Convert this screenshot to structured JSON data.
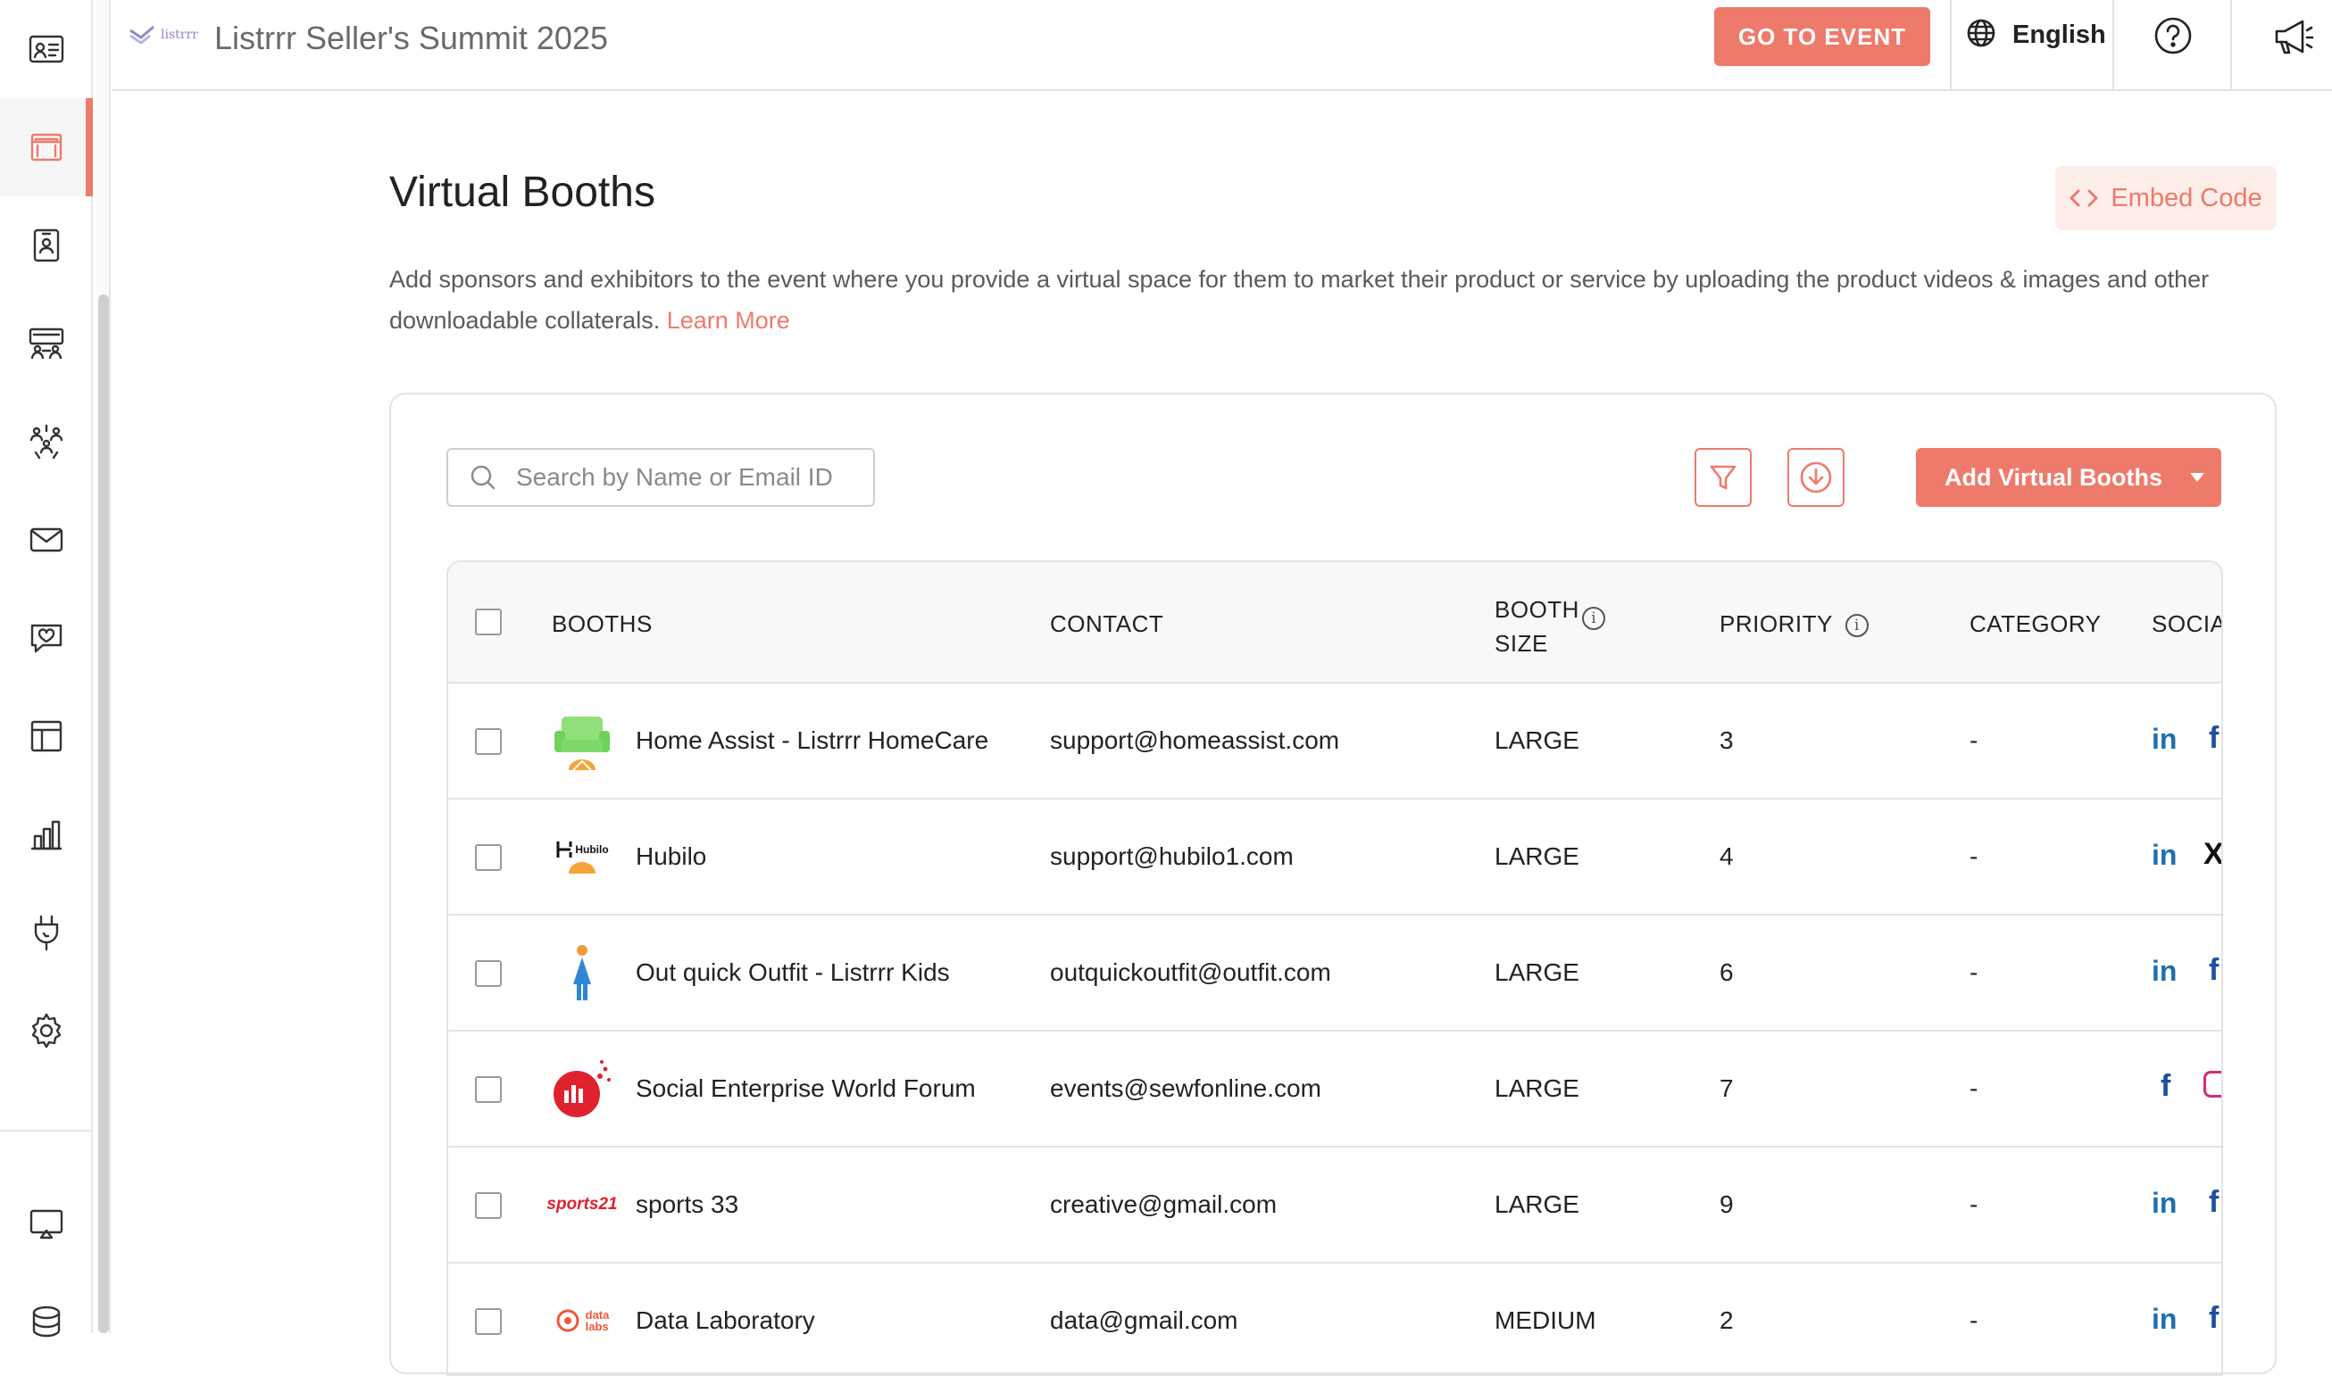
{
  "app": {
    "logo_text": "listrrr",
    "title": "Listrrr Seller's Summit 2025",
    "go_to_event_label": "GO TO EVENT",
    "language": "English"
  },
  "sidebar": {
    "items": [
      {
        "name": "attendees-icon"
      },
      {
        "name": "booth-icon",
        "active": true
      },
      {
        "name": "badge-icon"
      },
      {
        "name": "lounge-icon"
      },
      {
        "name": "networking-icon"
      },
      {
        "name": "mail-icon"
      },
      {
        "name": "engagement-icon"
      },
      {
        "name": "layout-icon"
      },
      {
        "name": "analytics-icon"
      },
      {
        "name": "integrations-icon"
      },
      {
        "name": "settings-icon"
      },
      {
        "name": "display-icon"
      },
      {
        "name": "database-icon"
      }
    ]
  },
  "page": {
    "title": "Virtual Booths",
    "embed_code_label": "Embed Code",
    "description": "Add sponsors and exhibitors to the event where you provide a virtual space for them to market their product or service by uploading the product videos & images and other downloadable collaterals.",
    "learn_more": "Learn More"
  },
  "toolbar": {
    "search_placeholder": "Search by Name or Email ID",
    "add_label": "Add Virtual Booths"
  },
  "table": {
    "headers": {
      "booths": "BOOTHS",
      "contact": "CONTACT",
      "booth_size_1": "BOOTH",
      "booth_size_2": "SIZE",
      "priority": "PRIORITY",
      "category": "CATEGORY",
      "social": "SOCIA"
    },
    "rows": [
      {
        "name": "Home Assist - Listrrr HomeCare",
        "contact": "support@homeassist.com",
        "size": "LARGE",
        "priority": "3",
        "category": "-",
        "logo": "sofa"
      },
      {
        "name": "Hubilo",
        "contact": "support@hubilo1.com",
        "size": "LARGE",
        "priority": "4",
        "category": "-",
        "logo": "hubilo",
        "logo_text": "Hubilo"
      },
      {
        "name": "Out quick Outfit - Listrrr Kids",
        "contact": "outquickoutfit@outfit.com",
        "size": "LARGE",
        "priority": "6",
        "category": "-",
        "logo": "kid"
      },
      {
        "name": "Social Enterprise World Forum",
        "contact": "events@sewfonline.com",
        "size": "LARGE",
        "priority": "7",
        "category": "-",
        "logo": "sewf"
      },
      {
        "name": "sports 33",
        "contact": "creative@gmail.com",
        "size": "LARGE",
        "priority": "9",
        "category": "-",
        "logo": "sports",
        "logo_text": "sports21"
      },
      {
        "name": "Data Laboratory",
        "contact": "data@gmail.com",
        "size": "MEDIUM",
        "priority": "2",
        "category": "-",
        "logo": "datalabs",
        "logo_text_1": "data",
        "logo_text_2": "labs"
      }
    ]
  },
  "colors": {
    "accent": "#ee7a6b",
    "accent_light": "#fdeeea",
    "linkedin": "#1e6fb0",
    "facebook": "#1e4fa0"
  }
}
